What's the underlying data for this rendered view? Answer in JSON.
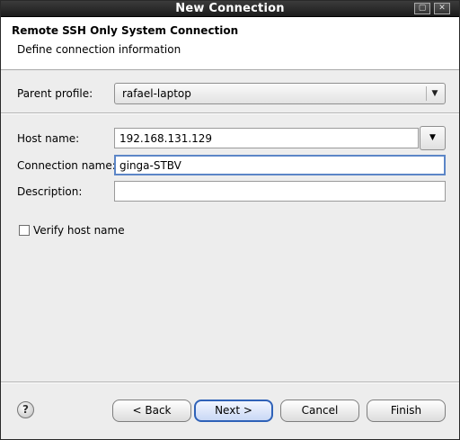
{
  "window": {
    "title": "New Connection",
    "minimize_glyph": "▢",
    "close_glyph": "✕"
  },
  "header": {
    "title": "Remote SSH Only System Connection",
    "description": "Define connection information"
  },
  "form": {
    "parent_profile": {
      "label": "Parent profile:",
      "value": "rafael-laptop"
    },
    "host_name": {
      "label": "Host name:",
      "value": "192.168.131.129"
    },
    "connection_name": {
      "label": "Connection name:",
      "value": "ginga-STBV"
    },
    "description": {
      "label": "Description:",
      "value": ""
    },
    "verify_host": {
      "label": "Verify host name",
      "checked": false
    }
  },
  "buttons": {
    "help": "?",
    "back": "< Back",
    "next": "Next >",
    "cancel": "Cancel",
    "finish": "Finish"
  },
  "icons": {
    "dropdown": "chevron-down-icon",
    "help": "help-icon"
  },
  "colors": {
    "focus_border": "#5c86c7",
    "default_button_border": "#2f62b8"
  }
}
